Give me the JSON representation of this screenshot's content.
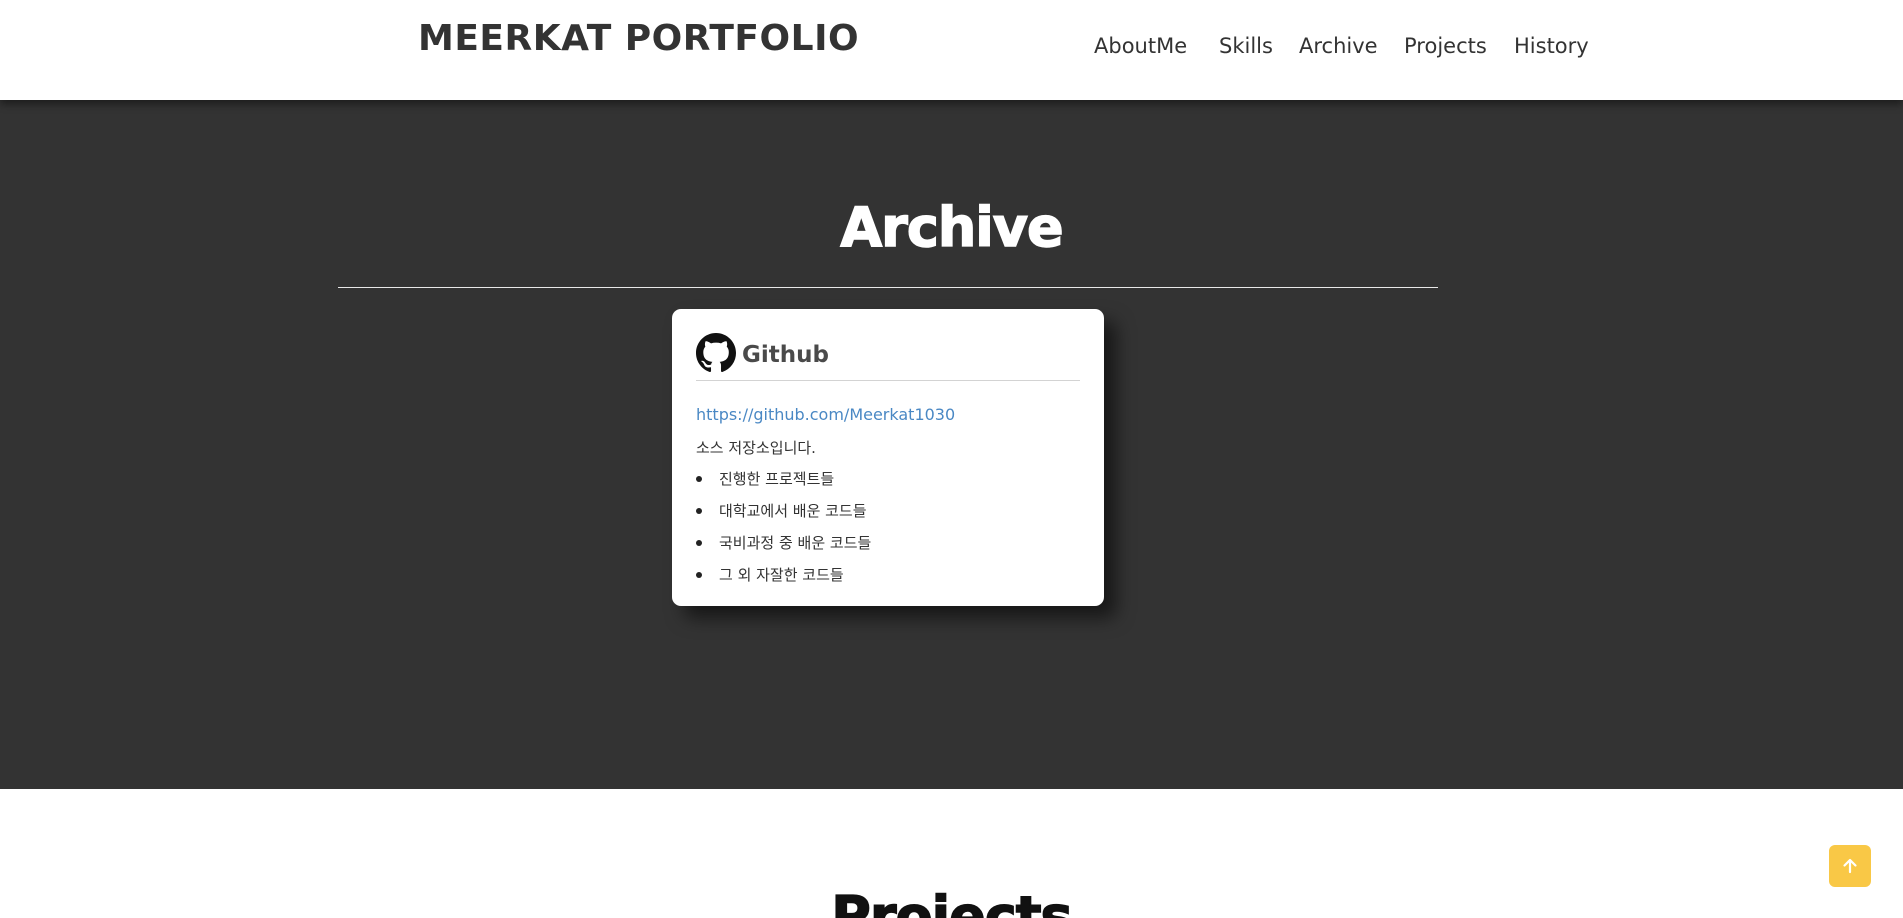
{
  "header": {
    "brand": "MEERKAT PORTFOLIO",
    "nav": [
      {
        "label": "AboutMe"
      },
      {
        "label": "Skills"
      },
      {
        "label": "Archive"
      },
      {
        "label": "Projects"
      },
      {
        "label": "History"
      }
    ]
  },
  "archive": {
    "title": "Archive",
    "card": {
      "icon": "github-icon",
      "title": "Github",
      "link": "https://github.com/Meerkat1030",
      "description": "소스 저장소입니다.",
      "items": [
        "진행한 프로젝트들",
        "대학교에서 배운 코드들",
        "국비과정 중 배운 코드들",
        "그 외 자잘한 코드들"
      ]
    }
  },
  "projects": {
    "title": "Projects"
  },
  "scroll_top": {
    "icon": "arrow-up-icon",
    "color": "#f9c846"
  },
  "colors": {
    "dark_section": "#333333",
    "link": "#4a88c4"
  }
}
